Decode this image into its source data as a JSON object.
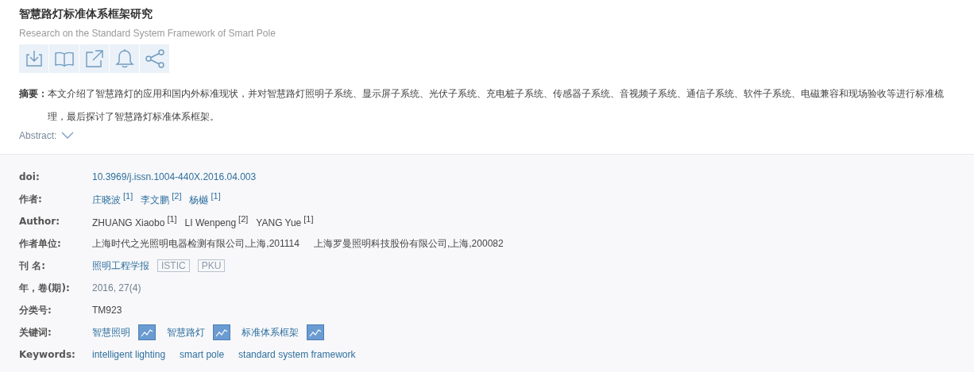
{
  "title": "智慧路灯标准体系框架研究",
  "subtitle": "Research on the Standard System Framework of Smart Pole",
  "toolbar": [
    {
      "kind": "download"
    },
    {
      "kind": "read"
    },
    {
      "kind": "export"
    },
    {
      "kind": "alert"
    },
    {
      "kind": "share"
    }
  ],
  "abstract": {
    "label": "摘要：",
    "text": "本文介绍了智慧路灯的应用和国内外标准现状，并对智慧路灯照明子系统、显示屏子系统、光伏子系统、充电桩子系统、传感器子系统、音视频子系统、通信子系统、软件子系统、电磁兼容和现场验收等进行标准梳理，最后探讨了智慧路灯标准体系框架。"
  },
  "abstract_toggle": {
    "label": "Abstract:",
    "expanded": false
  },
  "fields": [
    {
      "label": "doi:",
      "kind": "link",
      "value": "10.3969/j.issn.1004-440X.2016.04.003"
    },
    {
      "label": "作者:",
      "kind": "names",
      "link": true,
      "items": [
        {
          "name": "庄晓波",
          "note": "[1]"
        },
        {
          "name": "李文鹏",
          "note": "[2]"
        },
        {
          "name": "杨樾",
          "note": "[1]"
        }
      ]
    },
    {
      "label": "Author:",
      "kind": "names",
      "link": false,
      "items": [
        {
          "name": "ZHUANG Xiaobo",
          "note": "[1]"
        },
        {
          "name": "LI Wenpeng",
          "note": "[2]"
        },
        {
          "name": "YANG Yue",
          "note": "[1]"
        }
      ]
    },
    {
      "label": "作者单位:",
      "kind": "list",
      "items": [
        "上海时代之光照明电器检测有限公司,上海,201114",
        "上海罗曼照明科技股份有限公司,上海,200082"
      ]
    },
    {
      "label": "刊 名:",
      "kind": "journal",
      "value": "照明工程学报",
      "tags": [
        "ISTIC",
        "PKU"
      ]
    },
    {
      "label": "年，卷(期):",
      "kind": "muted",
      "value": "2016, 27(4)"
    },
    {
      "label": "分类号:",
      "kind": "text",
      "value": "TM923"
    },
    {
      "label": "关键词:",
      "kind": "keywords",
      "items": [
        "智慧照明",
        "智慧路灯",
        "标准体系框架"
      ]
    },
    {
      "label": "Keywords:",
      "kind": "links",
      "items": [
        "intelligent lighting",
        "smart pole",
        "standard system framework"
      ]
    }
  ]
}
